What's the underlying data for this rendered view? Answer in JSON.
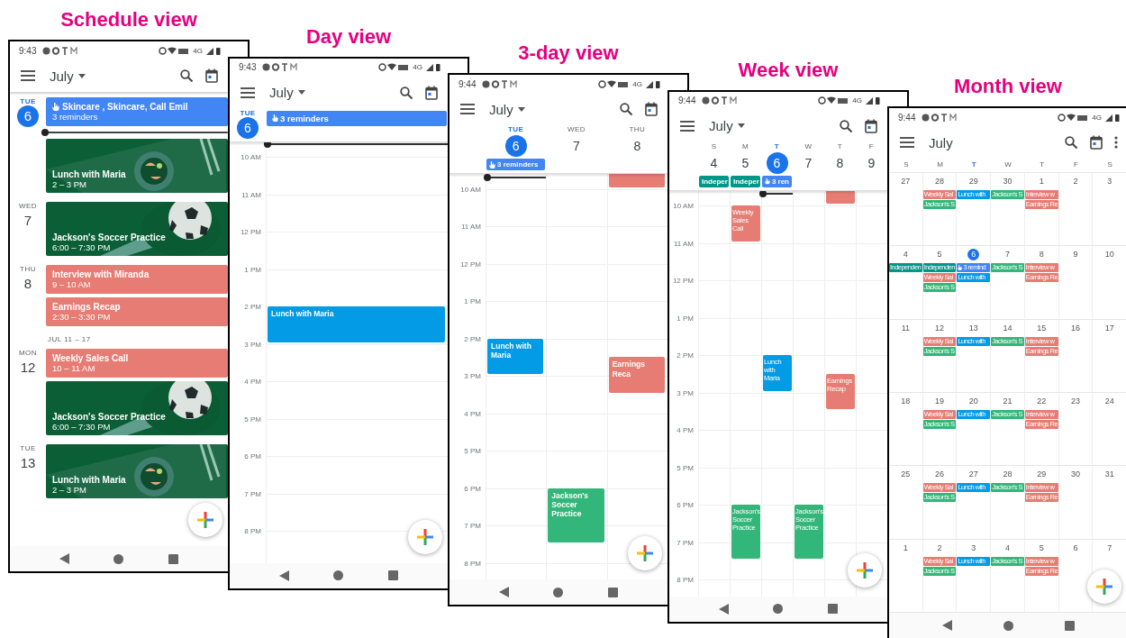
{
  "views": [
    {
      "kind": "schedule",
      "caption": "Schedule view",
      "status": {
        "time": "9:43",
        "network": "4G"
      },
      "header": {
        "month": "July",
        "dropdown": true,
        "more_menu": false
      },
      "entries": [
        {
          "kind": "day",
          "weekday": "TUE",
          "date": "6",
          "selected": true,
          "events": [
            {
              "kind": "reminder",
              "title": "Skincare , Skincare, Call Emil",
              "subtitle": "3 reminders",
              "color": "#4285f4"
            },
            {
              "kind": "now"
            },
            {
              "kind": "food",
              "title": "Lunch with Maria",
              "subtitle": "2 – 3 PM"
            }
          ]
        },
        {
          "kind": "day",
          "weekday": "WED",
          "date": "7",
          "selected": false,
          "events": [
            {
              "kind": "soccer",
              "title": "Jackson's Soccer Practice",
              "subtitle": "6:00 – 7:30 PM"
            }
          ]
        },
        {
          "kind": "day",
          "weekday": "THU",
          "date": "8",
          "selected": false,
          "events": [
            {
              "kind": "event",
              "title": "Interview with Miranda",
              "subtitle": "9 – 10 AM",
              "color": "#e67c73"
            },
            {
              "kind": "event",
              "title": "Earnings Recap",
              "subtitle": "2:30 – 3:30 PM",
              "color": "#e67c73"
            }
          ]
        },
        {
          "kind": "week_label",
          "text": "JUL 11 – 17"
        },
        {
          "kind": "day",
          "weekday": "MON",
          "date": "12",
          "selected": false,
          "events": [
            {
              "kind": "event",
              "title": "Weekly Sales Call",
              "subtitle": "10 – 11 AM",
              "color": "#e67c73"
            },
            {
              "kind": "soccer",
              "title": "Jackson's Soccer Practice",
              "subtitle": "6:00 – 7:30 PM"
            }
          ]
        },
        {
          "kind": "day",
          "weekday": "TUE",
          "date": "13",
          "selected": false,
          "events": [
            {
              "kind": "food",
              "title": "Lunch with Maria",
              "subtitle": "2 – 3 PM"
            }
          ]
        }
      ]
    },
    {
      "kind": "day",
      "caption": "Day view",
      "status": {
        "time": "9:43",
        "network": "4G"
      },
      "header": {
        "month": "July",
        "dropdown": true,
        "more_menu": false
      },
      "hours": [
        "10 AM",
        "11 AM",
        "12 PM",
        "1 PM",
        "2 PM",
        "3 PM",
        "4 PM",
        "5 PM",
        "6 PM",
        "7 PM",
        "8 PM"
      ],
      "columns": [
        {
          "weekday": "TUE",
          "date": "6",
          "selected": true,
          "now_line": true,
          "all_day": [
            {
              "kind": "reminder",
              "title": "3 reminders",
              "color": "#4285f4"
            }
          ],
          "events": [
            {
              "title": "Lunch with Maria",
              "kind": "slot14",
              "color": "#039be5"
            }
          ]
        }
      ]
    },
    {
      "kind": "threeday",
      "caption": "3-day view",
      "status": {
        "time": "9:44",
        "network": "4G"
      },
      "header": {
        "month": "July",
        "dropdown": true,
        "more_menu": false
      },
      "hours": [
        "10 AM",
        "11 AM",
        "12 PM",
        "1 PM",
        "2 PM",
        "3 PM",
        "4 PM",
        "5 PM",
        "6 PM",
        "7 PM",
        "8 PM"
      ],
      "columns": [
        {
          "weekday": "TUE",
          "date": "6",
          "selected": true,
          "now_line": true,
          "all_day": [
            {
              "kind": "reminder",
              "title": "3 reminders",
              "color": "#4285f4"
            }
          ],
          "events": [
            {
              "title": "Lunch with Maria",
              "kind": "slot14",
              "color": "#039be5"
            }
          ]
        },
        {
          "weekday": "WED",
          "date": "7",
          "selected": false,
          "events": [
            {
              "title": "Jackson's Soccer Practice",
              "kind": "slot18long",
              "color": "#33b679"
            }
          ]
        },
        {
          "weekday": "THU",
          "date": "8",
          "selected": false,
          "events": [
            {
              "kind": "slot9",
              "color": "#e67c73"
            },
            {
              "title": "Earnings Reca",
              "kind": "slot1430",
              "color": "#e67c73"
            }
          ]
        }
      ]
    },
    {
      "kind": "week",
      "caption": "Week view",
      "status": {
        "time": "9:44",
        "network": "4G"
      },
      "header": {
        "month": "July",
        "dropdown": true,
        "more_menu": false
      },
      "hours": [
        "10 AM",
        "11 AM",
        "12 PM",
        "1 PM",
        "2 PM",
        "3 PM",
        "4 PM",
        "5 PM",
        "6 PM",
        "7 PM",
        "8 PM"
      ],
      "columns": [
        {
          "weekday": "S",
          "date": "4",
          "selected": false,
          "all_day": [
            {
              "kind": "event",
              "title": "Indeper",
              "color": "#009688"
            }
          ]
        },
        {
          "weekday": "M",
          "date": "5",
          "selected": false,
          "all_day": [
            {
              "kind": "event",
              "title": "Indeper",
              "color": "#009688"
            }
          ],
          "events": [
            {
              "title": "Weekly Sales Call",
              "kind": "slot10",
              "color": "#e67c73"
            },
            {
              "title": "Jackson's Soccer Practice",
              "kind": "slot18long",
              "color": "#33b679"
            }
          ]
        },
        {
          "weekday": "T",
          "date": "6",
          "selected": true,
          "now_line": true,
          "all_day": [
            {
              "kind": "reminder",
              "title": "3 ren",
              "color": "#4285f4"
            }
          ],
          "events": [
            {
              "title": "Lunch with Maria",
              "kind": "slot14",
              "color": "#039be5"
            }
          ]
        },
        {
          "weekday": "W",
          "date": "7",
          "selected": false,
          "events": [
            {
              "title": "Jackson's Soccer Practice",
              "kind": "slot18long",
              "color": "#33b679"
            }
          ]
        },
        {
          "weekday": "T",
          "date": "8",
          "selected": false,
          "events": [
            {
              "kind": "slot9",
              "color": "#e67c73"
            },
            {
              "title": "Earnings Recap",
              "kind": "slot1430",
              "color": "#e67c73"
            }
          ]
        },
        {
          "weekday": "F",
          "date": "9",
          "selected": false
        }
      ]
    },
    {
      "kind": "month",
      "caption": "Month view",
      "status": {
        "time": "9:44",
        "network": "4G"
      },
      "header": {
        "month": "July",
        "dropdown": false,
        "more_menu": true
      },
      "weekdays": [
        {
          "label": "S",
          "selected": false
        },
        {
          "label": "M",
          "selected": false
        },
        {
          "label": "T",
          "selected": true
        },
        {
          "label": "W",
          "selected": false
        },
        {
          "label": "T",
          "selected": false
        },
        {
          "label": "F",
          "selected": false
        },
        {
          "label": "S",
          "selected": false
        }
      ],
      "weeks": [
        [
          {
            "date": "27",
            "selected": false
          },
          {
            "date": "28",
            "selected": false,
            "events": [
              {
                "kind": "event",
                "title": "Weekly Sal",
                "color": "#e67c73"
              },
              {
                "kind": "event",
                "title": "Jackson's S",
                "color": "#33b679"
              }
            ]
          },
          {
            "date": "29",
            "selected": false,
            "events": [
              {
                "kind": "event",
                "title": "Lunch with",
                "color": "#039be5"
              }
            ]
          },
          {
            "date": "30",
            "selected": false,
            "events": [
              {
                "kind": "event",
                "title": "Jackson's S",
                "color": "#33b679"
              }
            ]
          },
          {
            "date": "1",
            "selected": false,
            "events": [
              {
                "kind": "event",
                "title": "Interview w",
                "color": "#e67c73"
              },
              {
                "kind": "event",
                "title": "Earnings Re",
                "color": "#e67c73"
              }
            ]
          },
          {
            "date": "2",
            "selected": false
          },
          {
            "date": "3",
            "selected": false
          }
        ],
        [
          {
            "date": "4",
            "selected": false,
            "events": [
              {
                "kind": "event",
                "title": "Independen",
                "color": "#009688"
              }
            ]
          },
          {
            "date": "5",
            "selected": false,
            "events": [
              {
                "kind": "event",
                "title": "Independen",
                "color": "#009688"
              },
              {
                "kind": "event",
                "title": "Weekly Sal",
                "color": "#e67c73"
              },
              {
                "kind": "event",
                "title": "Jackson's S",
                "color": "#33b679"
              }
            ]
          },
          {
            "date": "6",
            "selected": true,
            "events": [
              {
                "kind": "reminder",
                "title": "3 remind",
                "color": "#4285f4"
              },
              {
                "kind": "event",
                "title": "Lunch with",
                "color": "#039be5"
              }
            ]
          },
          {
            "date": "7",
            "selected": false,
            "events": [
              {
                "kind": "event",
                "title": "Jackson's S",
                "color": "#33b679"
              }
            ]
          },
          {
            "date": "8",
            "selected": false,
            "events": [
              {
                "kind": "event",
                "title": "Interview w",
                "color": "#e67c73"
              },
              {
                "kind": "event",
                "title": "Earnings Re",
                "color": "#e67c73"
              }
            ]
          },
          {
            "date": "9",
            "selected": false
          },
          {
            "date": "10",
            "selected": false
          }
        ],
        [
          {
            "date": "11",
            "selected": false
          },
          {
            "date": "12",
            "selected": false,
            "events": [
              {
                "kind": "event",
                "title": "Weekly Sal",
                "color": "#e67c73"
              },
              {
                "kind": "event",
                "title": "Jackson's S",
                "color": "#33b679"
              }
            ]
          },
          {
            "date": "13",
            "selected": false,
            "events": [
              {
                "kind": "event",
                "title": "Lunch with",
                "color": "#039be5"
              }
            ]
          },
          {
            "date": "14",
            "selected": false,
            "events": [
              {
                "kind": "event",
                "title": "Jackson's S",
                "color": "#33b679"
              }
            ]
          },
          {
            "date": "15",
            "selected": false,
            "events": [
              {
                "kind": "event",
                "title": "Interview w",
                "color": "#e67c73"
              },
              {
                "kind": "event",
                "title": "Earnings Re",
                "color": "#e67c73"
              }
            ]
          },
          {
            "date": "16",
            "selected": false
          },
          {
            "date": "17",
            "selected": false
          }
        ],
        [
          {
            "date": "18",
            "selected": false
          },
          {
            "date": "19",
            "selected": false,
            "events": [
              {
                "kind": "event",
                "title": "Weekly Sal",
                "color": "#e67c73"
              },
              {
                "kind": "event",
                "title": "Jackson's S",
                "color": "#33b679"
              }
            ]
          },
          {
            "date": "20",
            "selected": false,
            "events": [
              {
                "kind": "event",
                "title": "Lunch with",
                "color": "#039be5"
              }
            ]
          },
          {
            "date": "21",
            "selected": false,
            "events": [
              {
                "kind": "event",
                "title": "Jackson's S",
                "color": "#33b679"
              }
            ]
          },
          {
            "date": "22",
            "selected": false,
            "events": [
              {
                "kind": "event",
                "title": "Interview w",
                "color": "#e67c73"
              },
              {
                "kind": "event",
                "title": "Earnings Re",
                "color": "#e67c73"
              }
            ]
          },
          {
            "date": "23",
            "selected": false
          },
          {
            "date": "24",
            "selected": false
          }
        ],
        [
          {
            "date": "25",
            "selected": false
          },
          {
            "date": "26",
            "selected": false,
            "events": [
              {
                "kind": "event",
                "title": "Weekly Sal",
                "color": "#e67c73"
              },
              {
                "kind": "event",
                "title": "Jackson's S",
                "color": "#33b679"
              }
            ]
          },
          {
            "date": "27",
            "selected": false,
            "events": [
              {
                "kind": "event",
                "title": "Lunch with",
                "color": "#039be5"
              }
            ]
          },
          {
            "date": "28",
            "selected": false,
            "events": [
              {
                "kind": "event",
                "title": "Jackson's S",
                "color": "#33b679"
              }
            ]
          },
          {
            "date": "29",
            "selected": false,
            "events": [
              {
                "kind": "event",
                "title": "Interview w",
                "color": "#e67c73"
              },
              {
                "kind": "event",
                "title": "Earnings Re",
                "color": "#e67c73"
              }
            ]
          },
          {
            "date": "30",
            "selected": false
          },
          {
            "date": "31",
            "selected": false
          }
        ],
        [
          {
            "date": "1",
            "selected": false
          },
          {
            "date": "2",
            "selected": false,
            "events": [
              {
                "kind": "event",
                "title": "Weekly Sal",
                "color": "#e67c73"
              },
              {
                "kind": "event",
                "title": "Jackson's S",
                "color": "#33b679"
              }
            ]
          },
          {
            "date": "3",
            "selected": false,
            "events": [
              {
                "kind": "event",
                "title": "Lunch with",
                "color": "#039be5"
              }
            ]
          },
          {
            "date": "4",
            "selected": false,
            "events": [
              {
                "kind": "event",
                "title": "Jackson's S",
                "color": "#33b679"
              }
            ]
          },
          {
            "date": "5",
            "selected": false,
            "events": [
              {
                "kind": "event",
                "title": "Interview w",
                "color": "#e67c73"
              },
              {
                "kind": "event",
                "title": "Earnings Re",
                "color": "#e67c73"
              }
            ]
          },
          {
            "date": "6",
            "selected": false
          },
          {
            "date": "7",
            "selected": false
          }
        ]
      ]
    }
  ]
}
